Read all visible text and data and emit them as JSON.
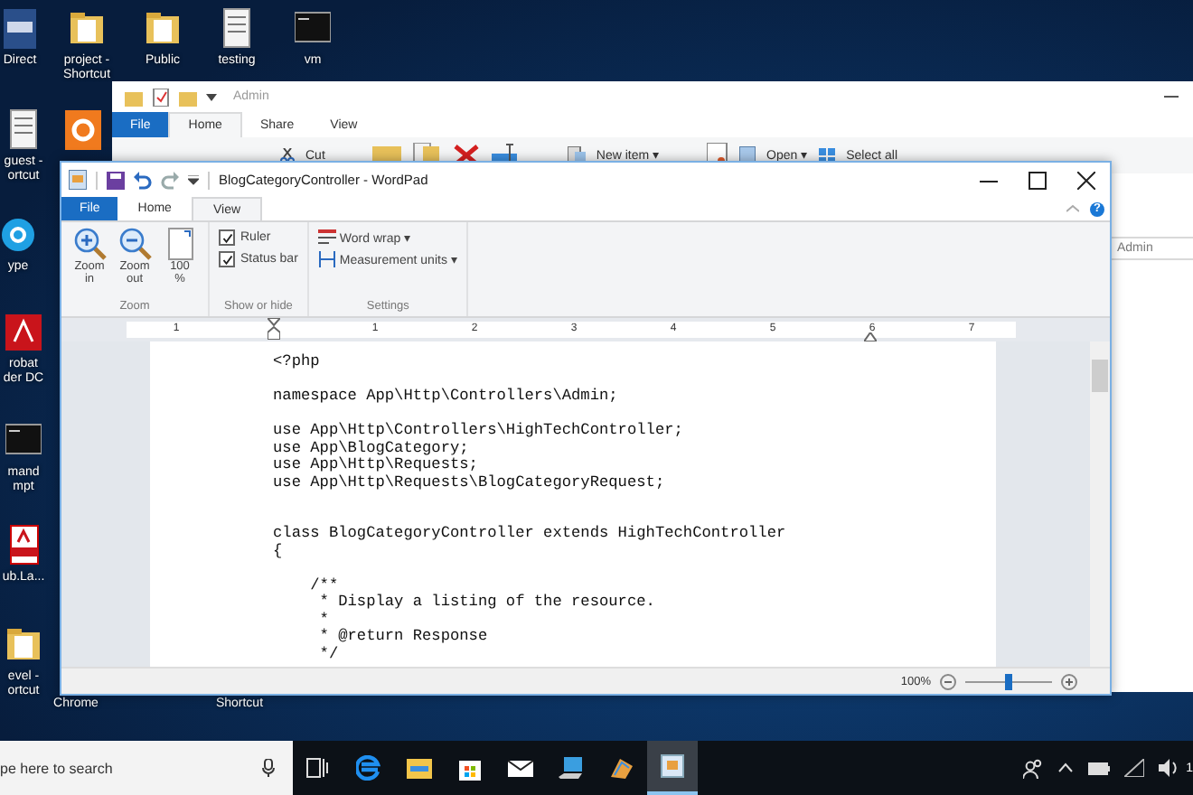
{
  "desktop_icons": [
    {
      "kind": "library",
      "label": "Direct"
    },
    {
      "kind": "folder",
      "label": "project -\nShortcut"
    },
    {
      "kind": "folder",
      "label": "Public"
    },
    {
      "kind": "doc",
      "label": "testing"
    },
    {
      "kind": "terminal",
      "label": "vm"
    },
    {
      "kind": "doc",
      "label": "guest -\nortcut"
    },
    {
      "kind": "xampp"
    },
    {
      "kind": "skype",
      "label": "ype"
    },
    {
      "kind": "acrobat",
      "label": "robat\nder DC"
    },
    {
      "kind": "terminal",
      "label": "mand\nmpt"
    },
    {
      "kind": "pdf",
      "label": "ub.La..."
    },
    {
      "kind": "folder",
      "label": "evel -\nortcut"
    },
    {
      "kind": "label",
      "label": "Chrome"
    },
    {
      "kind": "label",
      "label": "Shortcut"
    }
  ],
  "explorer": {
    "title": "Admin",
    "tabs": [
      {
        "label": "File",
        "kind": "file",
        "selected": false
      },
      {
        "label": "Home",
        "kind": "tab",
        "selected": true
      },
      {
        "label": "Share",
        "kind": "tab",
        "selected": false
      },
      {
        "label": "View",
        "kind": "tab",
        "selected": false
      }
    ],
    "ribbon": [
      "Cut",
      "New item ▾",
      "Open ▾",
      "Select all"
    ],
    "address": "Admin"
  },
  "wordpad": {
    "title": "BlogCategoryController - WordPad",
    "tabs": [
      {
        "label": "File",
        "kind": "file",
        "selected": false
      },
      {
        "label": "Home",
        "kind": "tab",
        "selected": false
      },
      {
        "label": "View",
        "kind": "tab",
        "selected": true
      }
    ],
    "help": "?",
    "zoom_group": {
      "label": "Zoom",
      "buttons": [
        "Zoom\nin",
        "Zoom\nout",
        "100\n%"
      ]
    },
    "show_hide": {
      "label": "Show or hide",
      "checkboxes": [
        {
          "label": "Ruler",
          "checked": true
        },
        {
          "label": "Status bar",
          "checked": true
        }
      ]
    },
    "settings": {
      "label": "Settings",
      "items": [
        "Word wrap ▾",
        "Measurement units ▾"
      ]
    },
    "ruler": [
      "1",
      "1",
      "2",
      "3",
      "4",
      "5",
      "6",
      "7"
    ],
    "document": "<?php\n\nnamespace App\\Http\\Controllers\\Admin;\n\nuse App\\Http\\Controllers\\HighTechController;\nuse App\\BlogCategory;\nuse App\\Http\\Requests;\nuse App\\Http\\Requests\\BlogCategoryRequest;\n\n\nclass BlogCategoryController extends HighTechController\n{\n\n    /**\n     * Display a listing of the resource.\n     *\n     * @return Response\n     */",
    "status": {
      "zoom": "100%",
      "level": 0.45
    }
  },
  "taskbar": {
    "search": {
      "placeholder": "pe here to search"
    },
    "apps": [
      {
        "kind": "taskview",
        "selected": false
      },
      {
        "kind": "edge",
        "selected": false
      },
      {
        "kind": "explorer",
        "selected": false
      },
      {
        "kind": "store",
        "selected": false
      },
      {
        "kind": "mail",
        "selected": false
      },
      {
        "kind": "laptop",
        "selected": false
      },
      {
        "kind": "paint",
        "selected": false
      },
      {
        "kind": "wordpad",
        "selected": true
      }
    ],
    "clock": "1"
  }
}
